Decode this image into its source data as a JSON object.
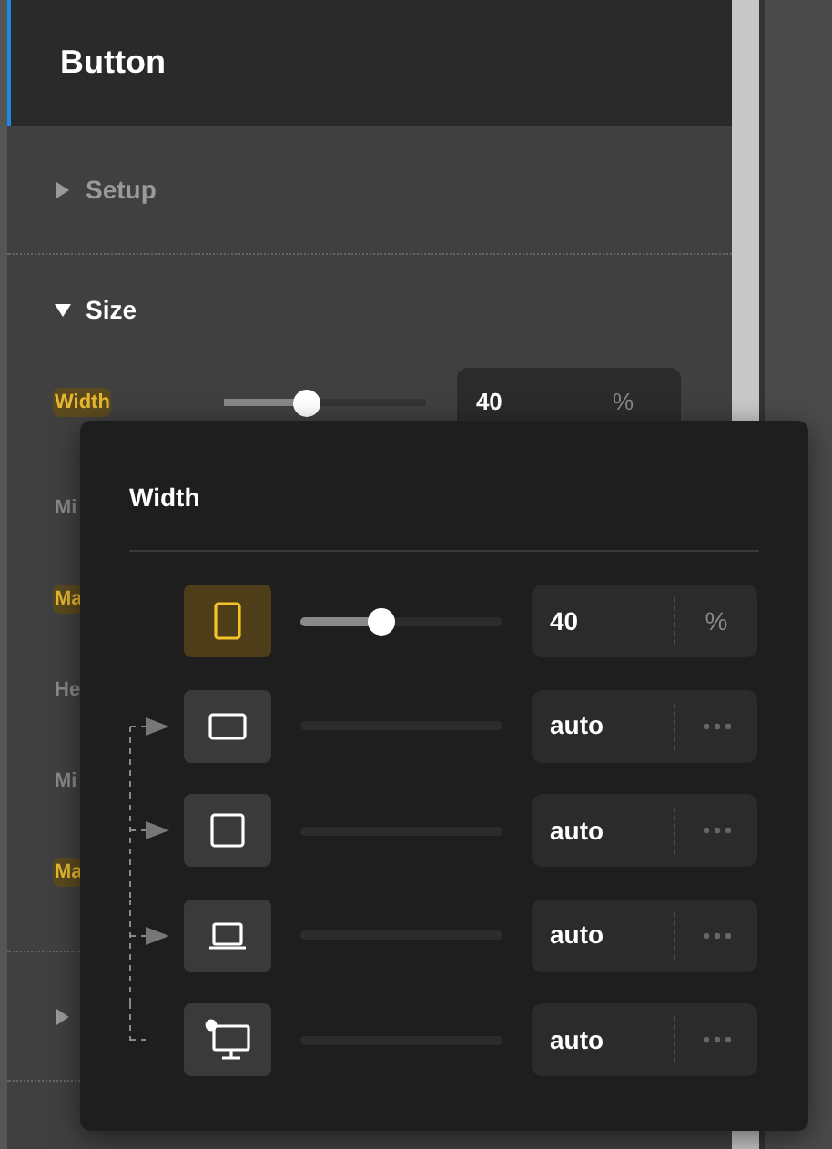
{
  "panel": {
    "title": "Button",
    "sections": [
      {
        "label": "Setup",
        "expanded": false
      },
      {
        "label": "Size",
        "expanded": true
      },
      {
        "expanded": false
      }
    ],
    "size_rows": [
      {
        "label": "Width",
        "highlighted": true,
        "level": 0.4,
        "value": "40",
        "unit": "%"
      },
      {
        "label": "Mi",
        "highlighted": false
      },
      {
        "label": "Ma",
        "highlighted": true
      },
      {
        "label": "He",
        "highlighted": false
      },
      {
        "label": "Mi",
        "highlighted": false
      },
      {
        "label": "Ma",
        "highlighted": true
      }
    ]
  },
  "popover": {
    "title": "Width",
    "breakpoints": [
      {
        "kind": "tablet-portrait",
        "selected": true,
        "level": 0.4,
        "value": "40",
        "unit": "%"
      },
      {
        "kind": "tablet-landscape",
        "selected": false,
        "linked": true,
        "arrow": true,
        "value": "auto"
      },
      {
        "kind": "square",
        "selected": false,
        "linked": true,
        "arrow": true,
        "value": "auto"
      },
      {
        "kind": "laptop",
        "selected": false,
        "linked": true,
        "arrow": true,
        "value": "auto"
      },
      {
        "kind": "desktop",
        "selected": false,
        "linked": true,
        "arrow": false,
        "value": "auto"
      }
    ]
  }
}
